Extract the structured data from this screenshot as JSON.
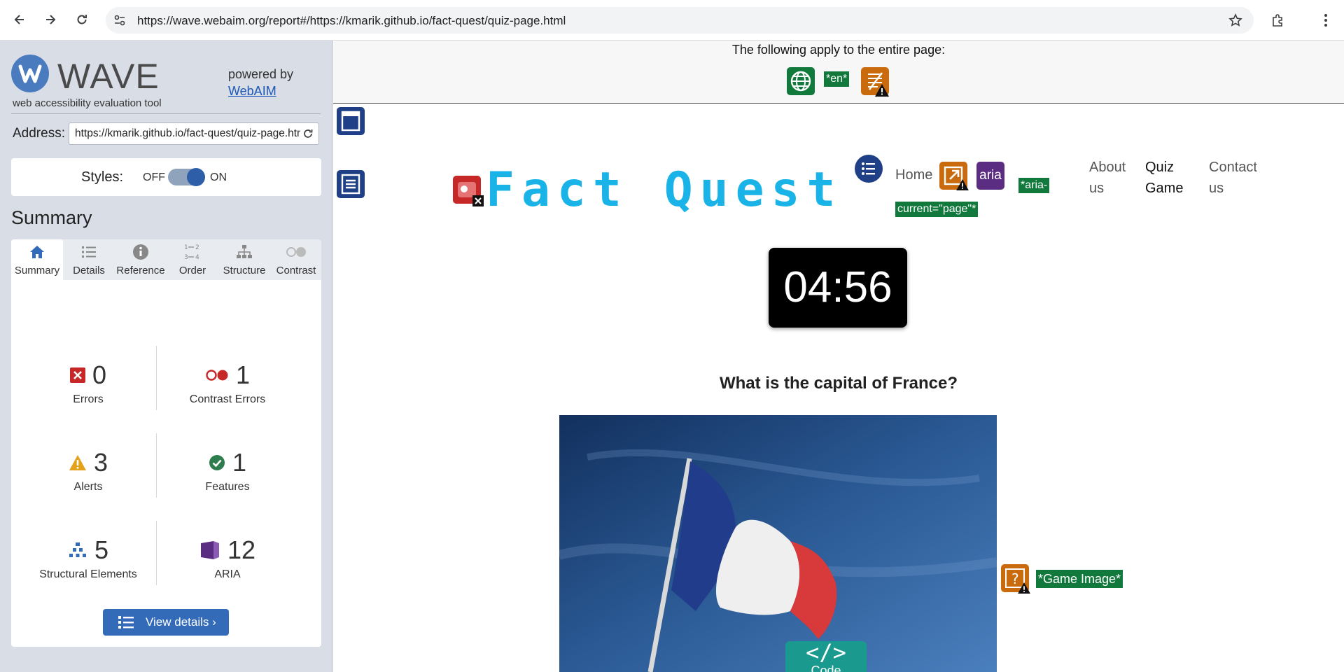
{
  "browser": {
    "url": "https://wave.webaim.org/report#/https://kmarik.github.io/fact-quest/quiz-page.html"
  },
  "wave": {
    "logo_text": "WAVE",
    "logo_subtitle": "web accessibility evaluation tool",
    "powered_by": "powered by",
    "webaim_link": "WebAIM",
    "address_label": "Address:",
    "address_value": "https://kmarik.github.io/fact-quest/quiz-page.html",
    "styles_label": "Styles:",
    "styles_off": "OFF",
    "styles_on": "ON",
    "styles_enabled": true,
    "summary_heading": "Summary",
    "tabs": [
      {
        "label": "Summary",
        "icon": "home-icon",
        "active": true
      },
      {
        "label": "Details",
        "icon": "list-icon",
        "active": false
      },
      {
        "label": "Reference",
        "icon": "info-icon",
        "active": false
      },
      {
        "label": "Order",
        "icon": "order-icon",
        "active": false
      },
      {
        "label": "Structure",
        "icon": "structure-icon",
        "active": false
      },
      {
        "label": "Contrast",
        "icon": "contrast-icon",
        "active": false
      }
    ],
    "stats": {
      "errors": {
        "count": "0",
        "label": "Errors"
      },
      "contrast": {
        "count": "1",
        "label": "Contrast Errors"
      },
      "alerts": {
        "count": "3",
        "label": "Alerts"
      },
      "features": {
        "count": "1",
        "label": "Features"
      },
      "structural": {
        "count": "5",
        "label": "Structural Elements"
      },
      "aria": {
        "count": "12",
        "label": "ARIA"
      }
    },
    "view_details": "View details ›",
    "colors": {
      "accent": "#336bb8",
      "error": "#c62828",
      "alert": "#e3a21a",
      "feature": "#2e7d4f",
      "aria": "#5b2d82"
    }
  },
  "page": {
    "banner_text": "The following apply to the entire page:",
    "lang_tag": "*en*",
    "title": "Fact Quest",
    "nav": {
      "home": "Home",
      "aria_badge": "aria",
      "aria_current": "*aria-current=\"page\"*",
      "about": "About us",
      "quiz": "Quiz Game",
      "contact": "Contact us"
    },
    "timer": "04:56",
    "question": "What is the capital of France?",
    "image_alt_tag": "*Game Image*",
    "code_badge_symbol": "</>",
    "code_badge_label": "Code"
  }
}
